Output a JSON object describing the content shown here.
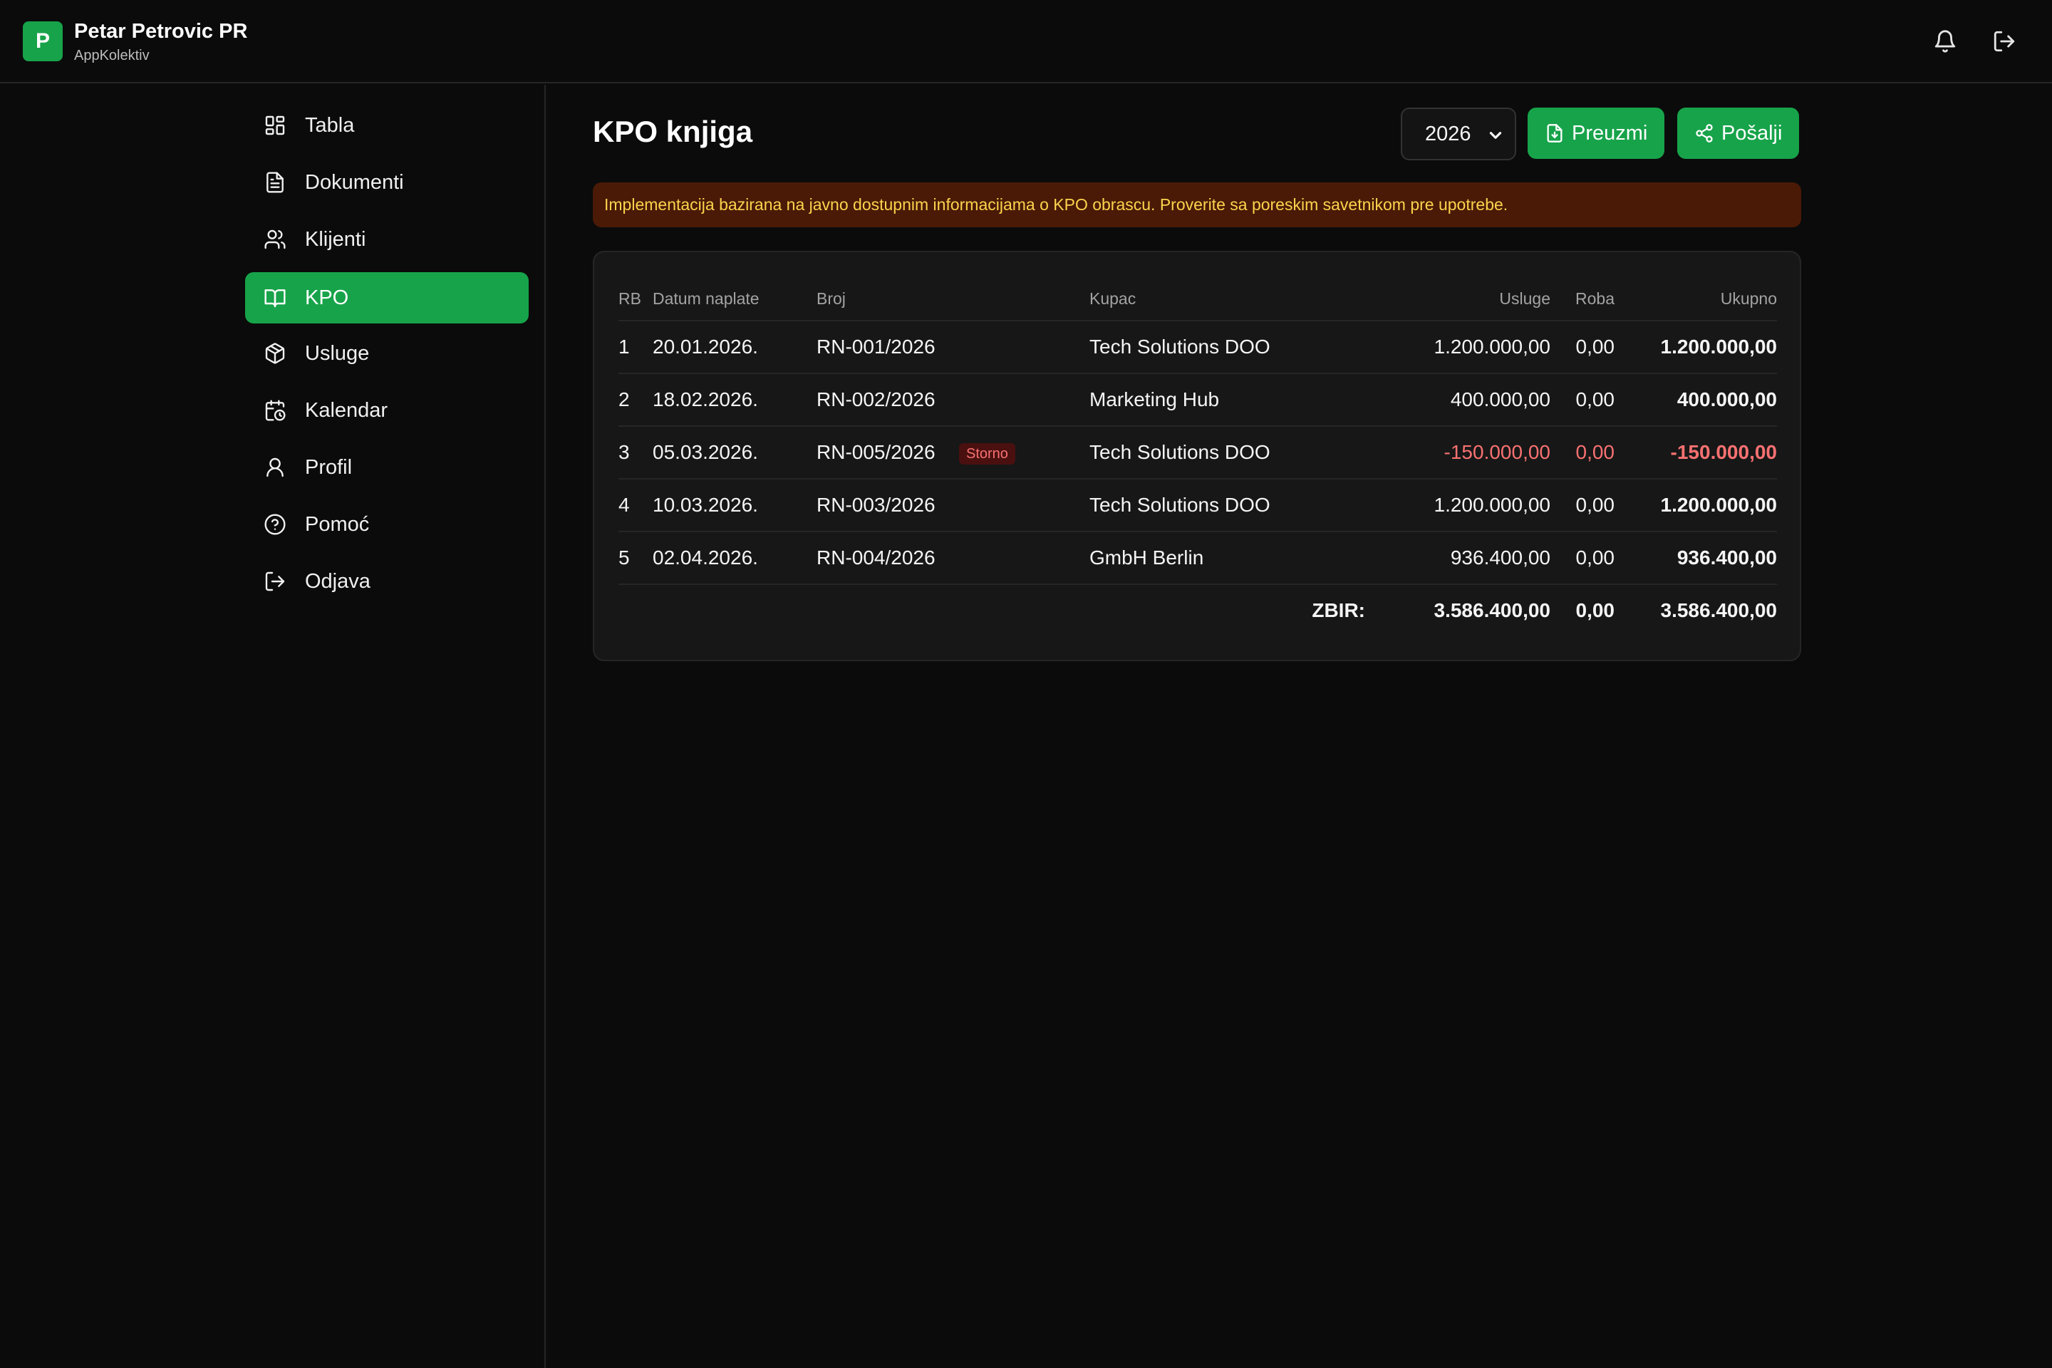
{
  "app": {
    "logo_letter": "P",
    "name": "Petar Petrovic PR",
    "subtitle": "AppKolektiv"
  },
  "topbar": {
    "icons": [
      "bell-icon",
      "logout-icon"
    ]
  },
  "sidebar": {
    "items": [
      {
        "label": "Tabla",
        "icon": "dashboard-icon",
        "active": false
      },
      {
        "label": "Dokumenti",
        "icon": "document-icon",
        "active": false
      },
      {
        "label": "Klijenti",
        "icon": "users-icon",
        "active": false
      },
      {
        "label": "KPO",
        "icon": "book-icon",
        "active": true
      },
      {
        "label": "Usluge",
        "icon": "box-icon",
        "active": false
      },
      {
        "label": "Kalendar",
        "icon": "calendar-icon",
        "active": false
      },
      {
        "label": "Profil",
        "icon": "user-icon",
        "active": false
      },
      {
        "label": "Pomoć",
        "icon": "help-icon",
        "active": false
      },
      {
        "label": "Odjava",
        "icon": "logout-icon",
        "active": false
      }
    ]
  },
  "main": {
    "title": "KPO knjiga",
    "year": "2026",
    "download_label": "Preuzmi",
    "send_label": "Pošalji",
    "notice": "Implementacija bazirana na javno dostupnim informacijama o KPO obrascu. Proverite sa poreskim savetnikom pre upotrebe."
  },
  "table": {
    "headers": {
      "rb": "RB",
      "datum": "Datum naplate",
      "broj": "Broj",
      "kupac": "Kupac",
      "usluge": "Usluge",
      "roba": "Roba",
      "ukupno": "Ukupno"
    },
    "rows": [
      {
        "rb": "1",
        "datum": "20.01.2026.",
        "broj": "RN-001/2026",
        "badge": "",
        "kupac": "Tech Solutions DOO",
        "usluge": "1.200.000,00",
        "roba": "0,00",
        "ukupno": "1.200.000,00",
        "negative": false
      },
      {
        "rb": "2",
        "datum": "18.02.2026.",
        "broj": "RN-002/2026",
        "badge": "",
        "kupac": "Marketing Hub",
        "usluge": "400.000,00",
        "roba": "0,00",
        "ukupno": "400.000,00",
        "negative": false
      },
      {
        "rb": "3",
        "datum": "05.03.2026.",
        "broj": "RN-005/2026",
        "badge": "Storno",
        "kupac": "Tech Solutions DOO",
        "usluge": "-150.000,00",
        "roba": "0,00",
        "ukupno": "-150.000,00",
        "negative": true
      },
      {
        "rb": "4",
        "datum": "10.03.2026.",
        "broj": "RN-003/2026",
        "badge": "",
        "kupac": "Tech Solutions DOO",
        "usluge": "1.200.000,00",
        "roba": "0,00",
        "ukupno": "1.200.000,00",
        "negative": false
      },
      {
        "rb": "5",
        "datum": "02.04.2026.",
        "broj": "RN-004/2026",
        "badge": "",
        "kupac": "GmbH Berlin",
        "usluge": "936.400,00",
        "roba": "0,00",
        "ukupno": "936.400,00",
        "negative": false
      }
    ],
    "totals": {
      "label": "ZBIR:",
      "usluge": "3.586.400,00",
      "roba": "0,00",
      "ukupno": "3.586.400,00"
    }
  }
}
